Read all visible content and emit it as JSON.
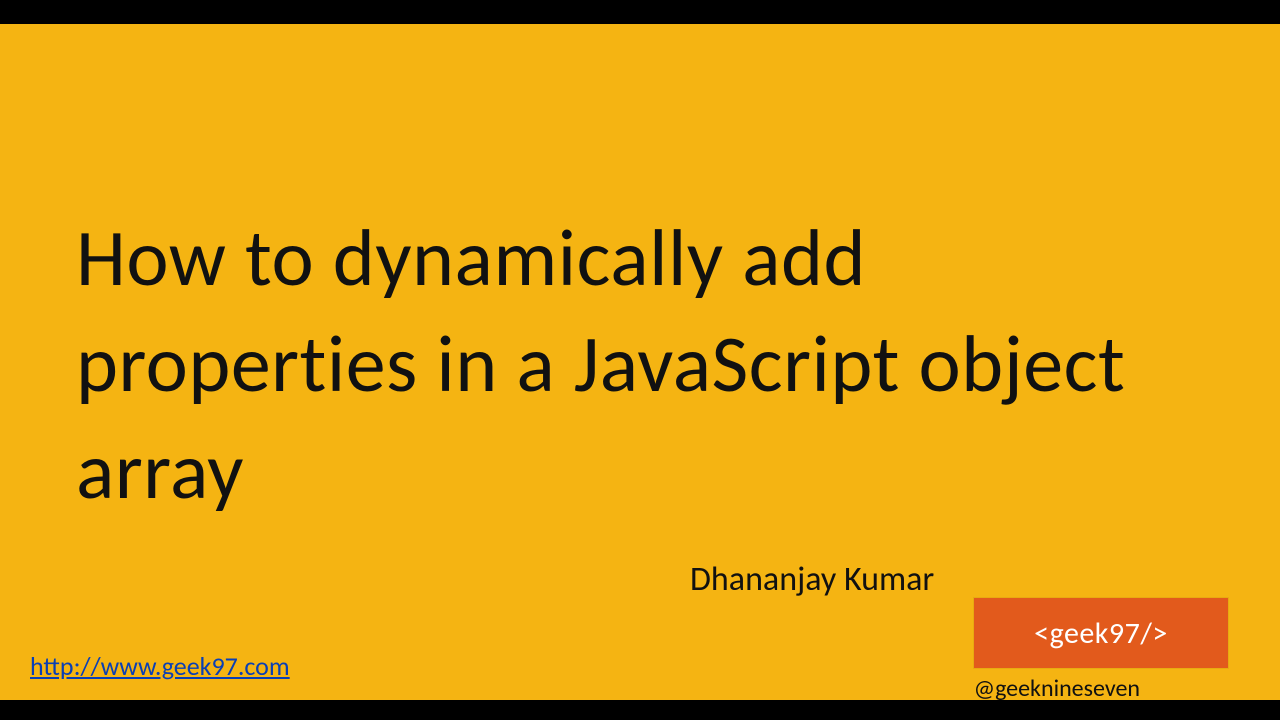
{
  "slide": {
    "title": "How to dynamically add properties in a JavaScript object array",
    "author": "Dhananjay Kumar",
    "site_url": "http://www.geek97.com",
    "brand_tag": "<geek97/>",
    "twitter_handle": "@geeknineseven"
  },
  "colors": {
    "background": "#f5b412",
    "badge_bg": "#e25a1c",
    "link": "#0a3fb5"
  }
}
